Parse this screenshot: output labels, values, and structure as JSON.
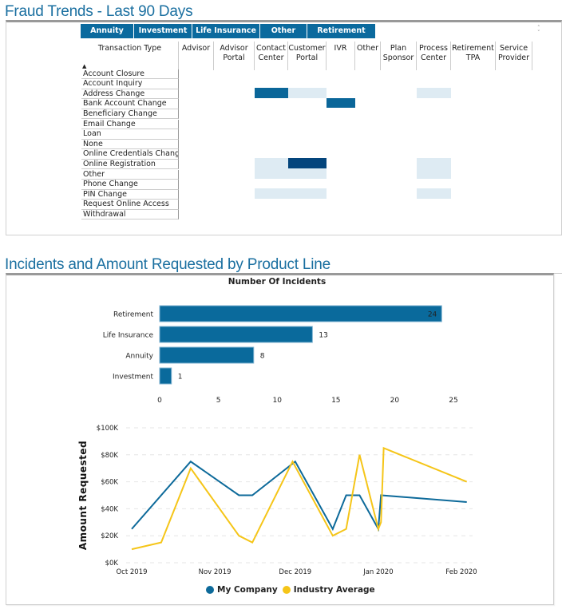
{
  "section1": {
    "title": "Fraud Trends - Last 90 Days",
    "tabs": [
      "Annuity",
      "Investment",
      "Life Insurance",
      "Other",
      "Retirement"
    ],
    "scroll_up": "˄",
    "scroll_down": "˅",
    "sort_indicator": "▲",
    "row_header": "Transaction Type",
    "columns": [
      "Advisor",
      "Advisor Portal",
      "Contact Center",
      "Customer Portal",
      "IVR",
      "Other",
      "Plan Sponsor",
      "Process Center",
      "Retirement TPA",
      "Service Provider"
    ],
    "rows": [
      "Account Closure",
      "Account Inquiry",
      "Address Change",
      "Bank Account Change",
      "Beneficiary Change",
      "Email Change",
      "Loan",
      "None",
      "Online Credentials Change",
      "Online Registration",
      "Other",
      "Phone Change",
      "PIN Change",
      "Request Online Access",
      "Withdrawal"
    ],
    "heatmap_levels": {
      "Address Change": {
        "Contact Center": 2,
        "Customer Portal": 1,
        "Process Center": 1
      },
      "Bank Account Change": {
        "IVR": 2
      },
      "Online Registration": {
        "Contact Center": 1,
        "Customer Portal": 3,
        "Process Center": 1
      },
      "Other": {
        "Contact Center": 1,
        "Customer Portal": 1,
        "Process Center": 1
      },
      "PIN Change": {
        "Contact Center": 1,
        "Customer Portal": 1,
        "Process Center": 1
      }
    },
    "level_colors": {
      "1": "#deebf3",
      "2": "#0a6699",
      "3": "#04457c"
    }
  },
  "section2": {
    "title": "Incidents and Amount Requested by Product Line"
  },
  "chart_data": [
    {
      "type": "bar",
      "orientation": "horizontal",
      "title": "Number Of Incidents",
      "categories": [
        "Retirement",
        "Life Insurance",
        "Annuity",
        "Investment"
      ],
      "values": [
        24,
        13,
        8,
        1
      ],
      "data_labels": [
        "24",
        "13",
        "8",
        "1"
      ],
      "xlim": [
        0,
        25
      ],
      "xticks": [
        0,
        5,
        10,
        15,
        20,
        25
      ],
      "bar_color": "#0a6a9c",
      "grid": false
    },
    {
      "type": "line",
      "title": "",
      "ylabel": "Amount Requested",
      "xlabel": "",
      "ylim": [
        0,
        100000
      ],
      "yticks": [
        "$0K",
        "$20K",
        "$40K",
        "$60K",
        "$80K",
        "$100K"
      ],
      "ytick_values": [
        0,
        20000,
        40000,
        60000,
        80000,
        100000
      ],
      "xticks": [
        "Oct 2019",
        "Nov 2019",
        "Dec 2019",
        "Jan 2020",
        "Feb 2020"
      ],
      "xtick_days": [
        0,
        31,
        61,
        92,
        123
      ],
      "grid": "dashed-horizontal",
      "legend": "bottom-center",
      "series": [
        {
          "name": "My Company",
          "color": "#0d6a9a",
          "points": [
            [
              0,
              25000
            ],
            [
              22,
              75000
            ],
            [
              40,
              50000
            ],
            [
              45,
              50000
            ],
            [
              61,
              75000
            ],
            [
              75,
              25000
            ],
            [
              80,
              50000
            ],
            [
              85,
              50000
            ],
            [
              92,
              25000
            ],
            [
              93,
              50000
            ],
            [
              125,
              45000
            ]
          ]
        },
        {
          "name": "Industry Average",
          "color": "#f5c518",
          "points": [
            [
              0,
              10000
            ],
            [
              11,
              15000
            ],
            [
              22,
              70000
            ],
            [
              40,
              20000
            ],
            [
              45,
              15000
            ],
            [
              60,
              75000
            ],
            [
              75,
              20000
            ],
            [
              80,
              25000
            ],
            [
              85,
              80000
            ],
            [
              92,
              25000
            ],
            [
              93,
              30000
            ],
            [
              94,
              85000
            ],
            [
              125,
              60000
            ]
          ]
        }
      ]
    }
  ]
}
